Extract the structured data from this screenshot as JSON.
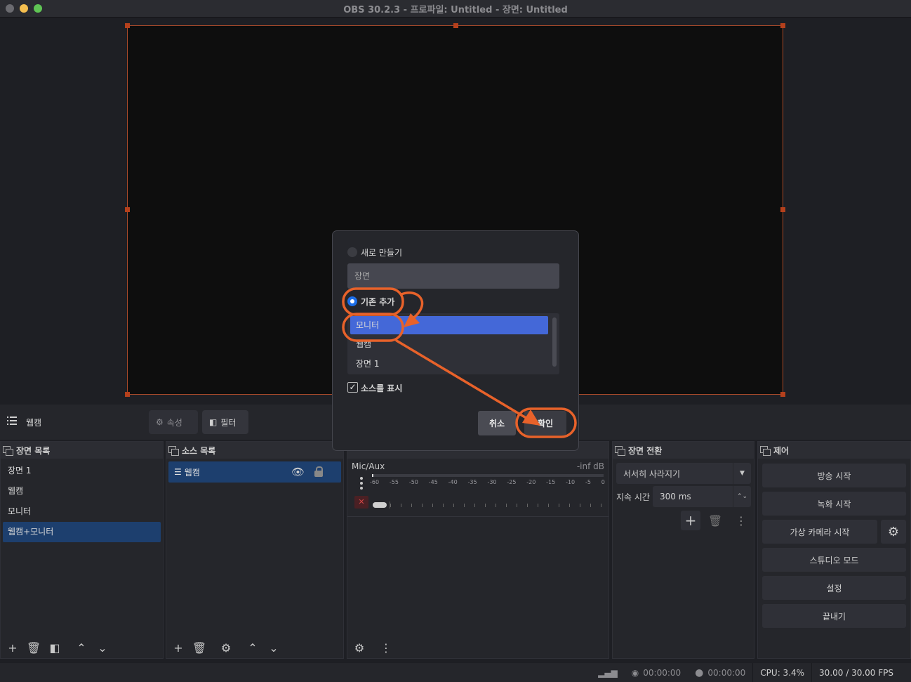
{
  "window": {
    "title": "OBS 30.2.3 - 프로파일: Untitled - 장면: Untitled"
  },
  "context_bar": {
    "source_name": "웹캠",
    "properties_label": "속성",
    "filters_label": "필터"
  },
  "scenes_dock": {
    "title": "장면 목록",
    "items": [
      "장면 1",
      "웹캠",
      "모니터",
      "웹캠+모니터"
    ],
    "selected_index": 3
  },
  "sources_dock": {
    "title": "소스 목록",
    "items": [
      "웹캠"
    ]
  },
  "mixer_dock": {
    "channel_name": "Mic/Aux",
    "level": "-inf dB",
    "ticks": [
      "-60",
      "-55",
      "-50",
      "-45",
      "-40",
      "-35",
      "-30",
      "-25",
      "-20",
      "-15",
      "-10",
      "-5",
      "0"
    ]
  },
  "transitions_dock": {
    "title": "장면 전환",
    "transition_type": "서서히 사라지기",
    "duration_label": "지속 시간",
    "duration_value": "300 ms"
  },
  "controls_dock": {
    "title": "제어",
    "start_streaming": "방송 시작",
    "start_recording": "녹화 시작",
    "start_virtual_camera": "가상 카메라 시작",
    "studio_mode": "스튜디오 모드",
    "settings": "설정",
    "exit": "끝내기"
  },
  "status_bar": {
    "stream_time": "00:00:00",
    "record_time": "00:00:00",
    "cpu": "CPU: 3.4%",
    "fps": "30.00 / 30.00 FPS"
  },
  "dialog": {
    "create_new_label": "새로 만들기",
    "name_placeholder": "장면",
    "add_existing_label": "기존 추가",
    "existing_scenes": [
      "모니터",
      "웹캠",
      "장면 1"
    ],
    "selected_scene_index": 0,
    "create_new_selected": false,
    "add_existing_selected": true,
    "show_sources_label": "소스를 표시",
    "show_sources_checked": true,
    "cancel_label": "취소",
    "ok_label": "확인"
  },
  "colors": {
    "accent_blue": "#4468d8",
    "selection_blue": "#1d3f6e",
    "annotation_orange": "#e8622a",
    "canvas_border": "#a94a2a"
  }
}
